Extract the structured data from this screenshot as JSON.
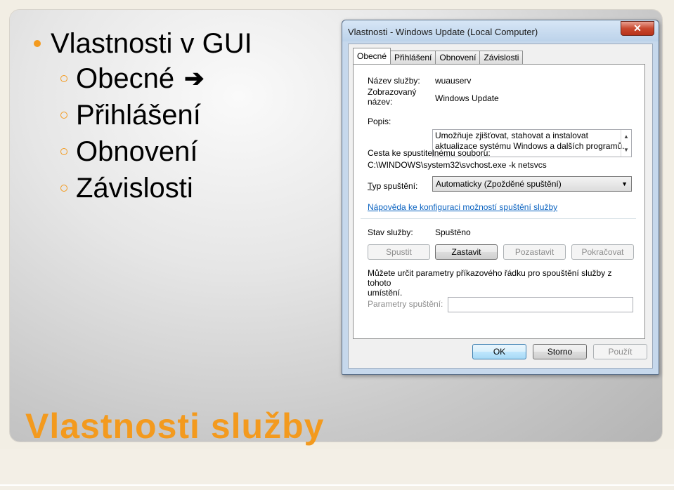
{
  "slide": {
    "bullet_main": "Vlastnosti v GUI",
    "sub_bullets": [
      "Obecné",
      "Přihlášení",
      "Obnovení",
      "Závislosti"
    ],
    "arrow_glyph": "➔",
    "title": "Vlastnosti služby"
  },
  "dialog": {
    "title": "Vlastnosti - Windows Update (Local Computer)",
    "close_glyph": "✕",
    "tabs": [
      "Obecné",
      "Přihlášení",
      "Obnovení",
      "Závislosti"
    ],
    "service_name_label": "Název služby:",
    "service_name": "wuauserv",
    "display_name_label_1": "Zobrazovaný",
    "display_name_label_2": "název:",
    "display_name": "Windows Update",
    "description_label": "Popis:",
    "description_1": "Umožňuje zjišťovat, stahovat a instalovat",
    "description_2": "aktualizace systému Windows a dalších programů.",
    "path_label": "Cesta ke spustitelnému souboru:",
    "path": "C:\\WINDOWS\\system32\\svchost.exe -k netsvcs",
    "startup_label_u": "T",
    "startup_label_rest": "yp spuštění:",
    "startup_value": "Automaticky (Zpožděné spuštění)",
    "help_link": "Nápověda ke konfiguraci možností spuštění služby",
    "status_label": "Stav služby:",
    "status_value": "Spuštěno",
    "start_button": "Spustit",
    "stop_button": "Zastavit",
    "pause_button": "Pozastavit",
    "resume_button": "Pokračovat",
    "params_hint_1": "Můžete určit parametry příkazového řádku pro spouštění služby z tohoto",
    "params_hint_2": "umístění.",
    "params_label": "Parametry spuštění:",
    "params_value": "",
    "ok_button": "OK",
    "cancel_button": "Storno",
    "apply_button": "Použít"
  }
}
